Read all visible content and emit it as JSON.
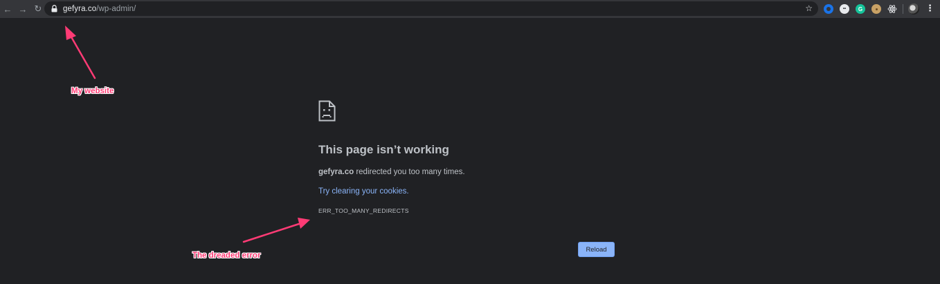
{
  "browser": {
    "url_host": "gefyra.co",
    "url_path": "/wp-admin/",
    "nav": {
      "back_icon": "arrow-left-icon",
      "forward_icon": "arrow-right-icon",
      "reload_icon": "reload-icon"
    },
    "extensions": [
      {
        "name": "extension-blue-ring-icon",
        "color": "#1a73e8",
        "glyph": ""
      },
      {
        "name": "extension-eyes-icon",
        "color": "#e8eaed",
        "glyph": "••"
      },
      {
        "name": "extension-grammarly-icon",
        "color": "#15c39a",
        "glyph": "G"
      },
      {
        "name": "extension-cookie-icon",
        "color": "#c8a165",
        "glyph": ""
      },
      {
        "name": "extension-react-icon",
        "color": "#61dafb",
        "glyph": ""
      }
    ]
  },
  "error_page": {
    "title": "This page isn’t working",
    "host": "gefyra.co",
    "message_rest": " redirected you too many times.",
    "suggestion_link": "Try clearing your cookies.",
    "error_code": "ERR_TOO_MANY_REDIRECTS",
    "reload_label": "Reload"
  },
  "annotations": {
    "website": "My website",
    "error": "The dreaded error"
  },
  "colors": {
    "page_bg": "#202124",
    "toolbar_bg": "#35363a",
    "link": "#8ab4f8",
    "annotation": "#ff3b75"
  }
}
